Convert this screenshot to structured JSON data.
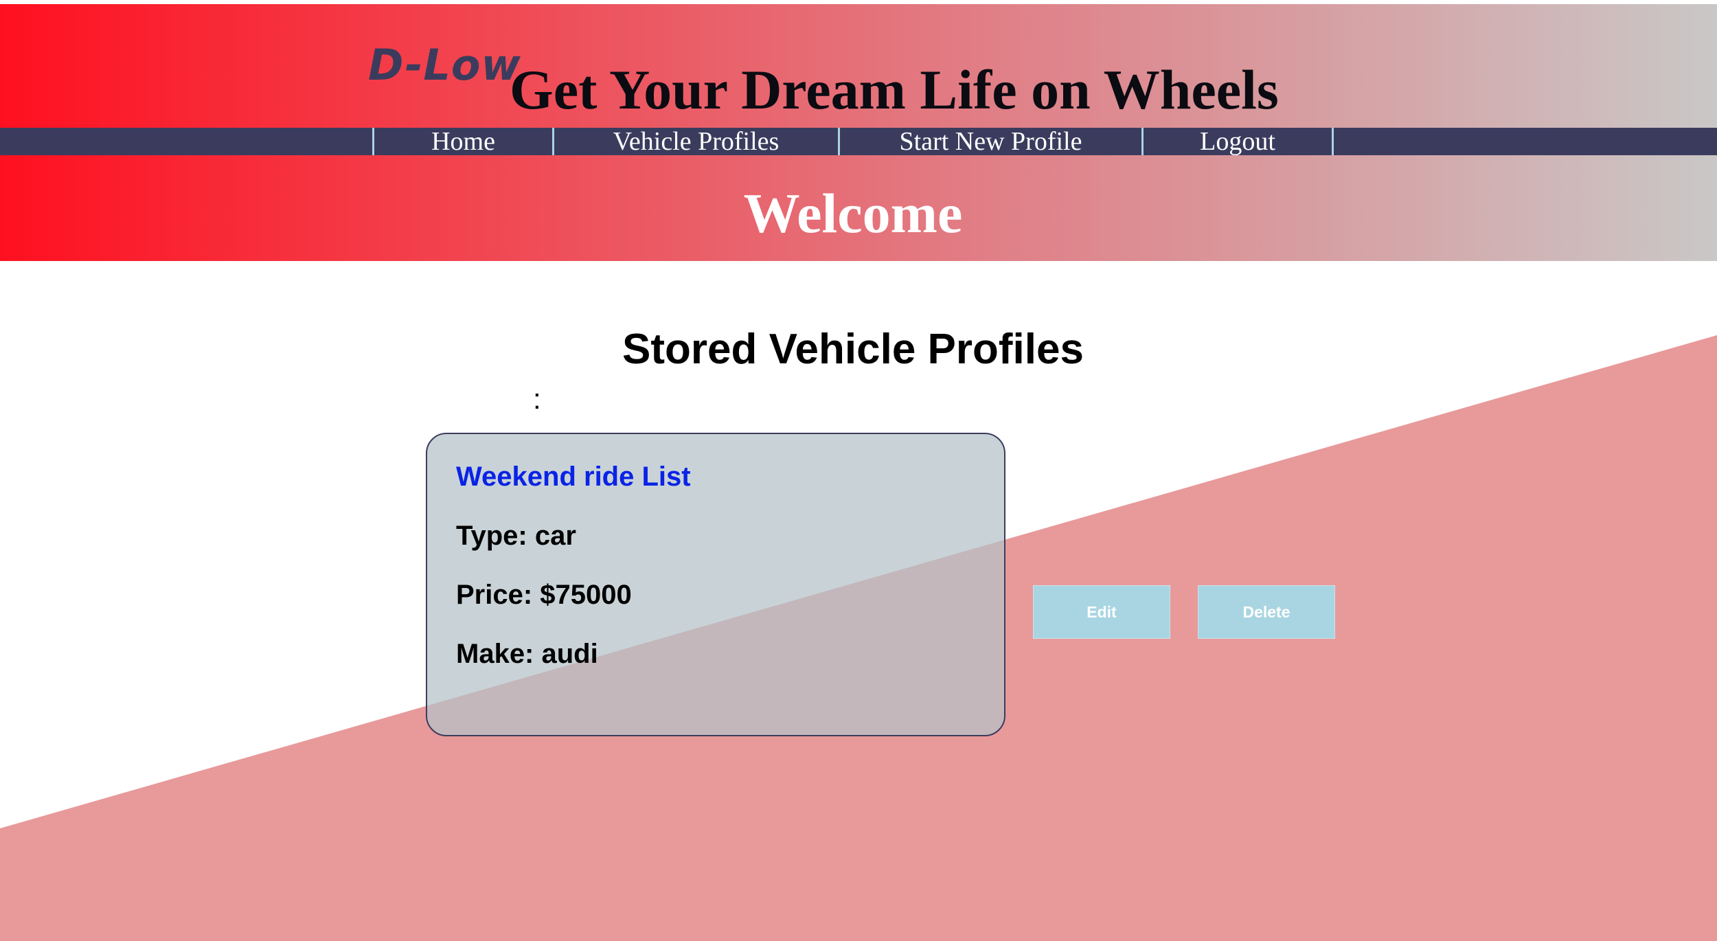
{
  "header": {
    "logo": "D-Low",
    "tagline": "Get Your Dream Life on Wheels",
    "welcome": "Welcome"
  },
  "nav": {
    "items": [
      {
        "label": "Home"
      },
      {
        "label": "Vehicle Profiles"
      },
      {
        "label": "Start New Profile"
      },
      {
        "label": "Logout"
      }
    ]
  },
  "main": {
    "title": "Stored Vehicle Profiles",
    "separator": ":"
  },
  "profile": {
    "name": "Weekend ride List",
    "type_text": "Type: car",
    "price_text": "Price: $75000",
    "make_text": "Make: audi"
  },
  "actions": {
    "edit_label": "Edit",
    "delete_label": "Delete"
  },
  "colors": {
    "nav_bg": "#3b3c5d",
    "header_gradient_start": "#ff1020",
    "header_gradient_end": "#cac7c7",
    "diagonal_fill": "#e8999a",
    "card_title": "#0a23e6",
    "button_bg": "#a9d5e2"
  }
}
